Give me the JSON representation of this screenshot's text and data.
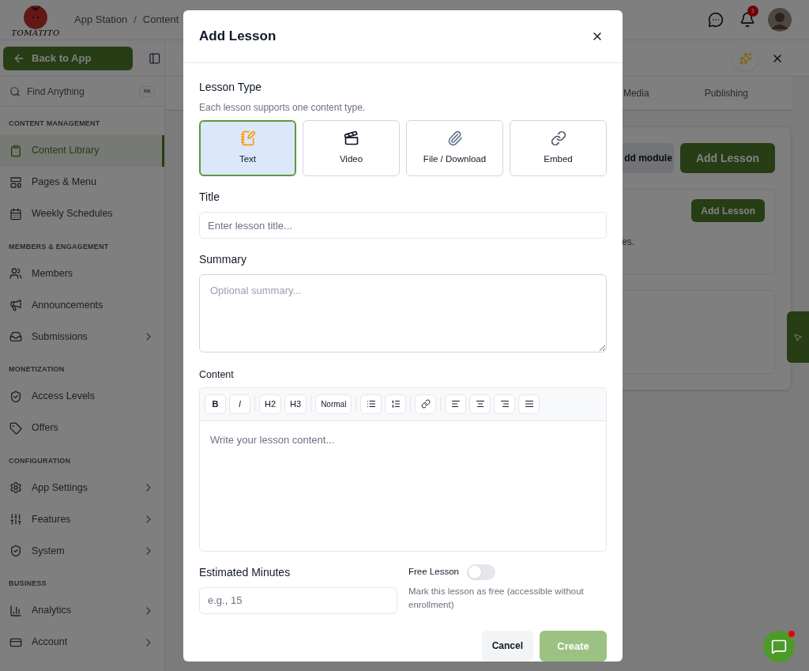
{
  "header": {
    "logo_text": "TOMATITO",
    "breadcrumb": [
      "App Station",
      "Content"
    ],
    "breadcrumb_separator": "/",
    "notification_count": "1"
  },
  "sidebar": {
    "back_button": "Back to App",
    "search": {
      "placeholder": "Find Anything",
      "shortcut": "⌘K"
    },
    "sections": [
      {
        "heading": "CONTENT MANAGEMENT",
        "items": [
          {
            "label": "Content Library",
            "selected": true,
            "expandable": false
          },
          {
            "label": "Pages & Menu",
            "selected": false,
            "expandable": false
          },
          {
            "label": "Weekly Schedules",
            "selected": false,
            "expandable": false
          }
        ]
      },
      {
        "heading": "MEMBERS & ENGAGEMENT",
        "items": [
          {
            "label": "Members",
            "selected": false,
            "expandable": false
          },
          {
            "label": "Announcements",
            "selected": false,
            "expandable": false
          },
          {
            "label": "Submissions",
            "selected": false,
            "expandable": true
          }
        ]
      },
      {
        "heading": "MONETIZATION",
        "items": [
          {
            "label": "Access Levels",
            "selected": false,
            "expandable": false
          },
          {
            "label": "Offers",
            "selected": false,
            "expandable": false
          }
        ]
      },
      {
        "heading": "CONFIGURATION",
        "items": [
          {
            "label": "App Settings",
            "selected": false,
            "expandable": true
          },
          {
            "label": "Features",
            "selected": false,
            "expandable": true
          },
          {
            "label": "System",
            "selected": false,
            "expandable": true
          }
        ]
      },
      {
        "heading": "BUSINESS",
        "items": [
          {
            "label": "Analytics",
            "selected": false,
            "expandable": true
          },
          {
            "label": "Account",
            "selected": false,
            "expandable": true
          }
        ]
      }
    ]
  },
  "main": {
    "tabs": [
      "Media",
      "Publishing"
    ],
    "module_button": "dd module",
    "add_lesson_button": "Add Lesson",
    "module_card": {
      "add_lesson_button": "Add Lesson",
      "text": "es."
    }
  },
  "dialog": {
    "title": "Add Lesson",
    "lesson_type": {
      "label": "Lesson Type",
      "hint": "Each lesson supports one content type.",
      "options": [
        {
          "label": "Text",
          "selected": true
        },
        {
          "label": "Video",
          "selected": false
        },
        {
          "label": "File / Download",
          "selected": false
        },
        {
          "label": "Embed",
          "selected": false
        }
      ]
    },
    "title_field": {
      "label": "Title",
      "placeholder": "Enter lesson title..."
    },
    "summary_field": {
      "label": "Summary",
      "placeholder": "Optional summary..."
    },
    "content": {
      "label": "Content",
      "placeholder": "Write your lesson content...",
      "toolbar": [
        [
          {
            "kind": "bold",
            "label": "B"
          },
          {
            "kind": "italic",
            "label": "I"
          }
        ],
        [
          {
            "kind": "text",
            "label": "H2"
          },
          {
            "kind": "text",
            "label": "H3"
          }
        ],
        [
          {
            "kind": "text",
            "label": "Normal"
          }
        ],
        [
          {
            "kind": "bullet-list"
          },
          {
            "kind": "numbered-list"
          }
        ],
        [
          {
            "kind": "link"
          }
        ],
        [
          {
            "kind": "align-left"
          },
          {
            "kind": "align-center"
          },
          {
            "kind": "align-right"
          },
          {
            "kind": "justify"
          }
        ]
      ]
    },
    "minutes_field": {
      "label": "Estimated Minutes",
      "placeholder": "e.g., 15"
    },
    "free_lesson": {
      "label": "Free Lesson",
      "on": false,
      "description": "Mark this lesson as free (accessible without enrollment)"
    },
    "buttons": {
      "cancel": "Cancel",
      "create": "Create",
      "create_disabled": true
    }
  }
}
